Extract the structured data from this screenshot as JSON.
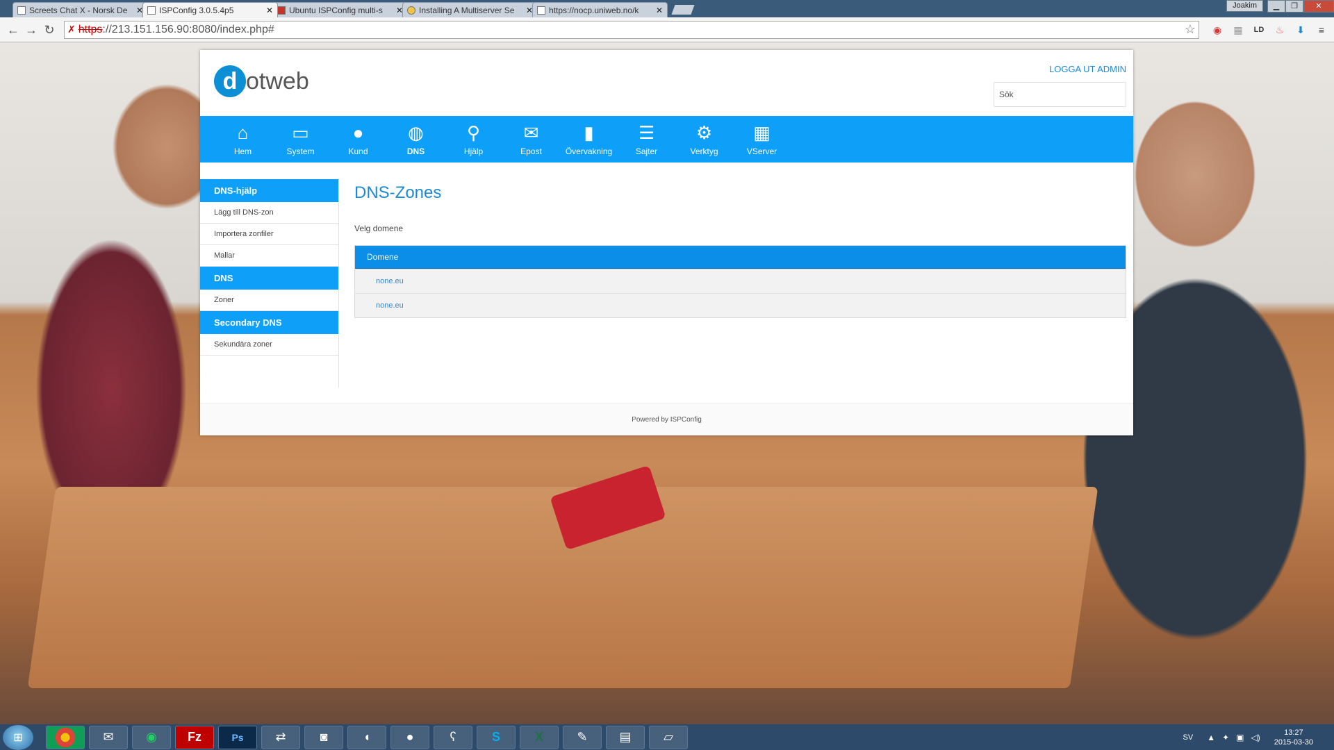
{
  "browser": {
    "tabs": [
      {
        "label": "Screets Chat X - Norsk De",
        "icon": "page-icon"
      },
      {
        "label": "ISPConfig 3.0.5.4p5",
        "icon": "page-icon",
        "active": true
      },
      {
        "label": "Ubuntu ISPConfig multi-s",
        "icon": "ispconfig-icon"
      },
      {
        "label": "Installing A Multiserver Se",
        "icon": "bulb-icon"
      },
      {
        "label": "https://nocp.uniweb.no/k",
        "icon": "page-icon"
      }
    ],
    "user_badge": "Joakim",
    "url_scheme": "https",
    "url_rest": "://213.151.156.90:8080/index.php#"
  },
  "header": {
    "logo_letter": "d",
    "logo_text": "otweb",
    "logout": "LOGGA UT ADMIN",
    "search_placeholder": "Sök"
  },
  "nav": [
    {
      "label": "Hem",
      "icon": "home-icon",
      "glyph": "⌂"
    },
    {
      "label": "System",
      "icon": "monitor-icon",
      "glyph": "▭"
    },
    {
      "label": "Kund",
      "icon": "user-icon",
      "glyph": "●"
    },
    {
      "label": "DNS",
      "icon": "globe-icon",
      "glyph": "◍",
      "active": true
    },
    {
      "label": "Hjälp",
      "icon": "search-icon",
      "glyph": "⚲"
    },
    {
      "label": "Epost",
      "icon": "envelope-icon",
      "glyph": "✉"
    },
    {
      "label": "Övervakning",
      "icon": "bar-chart-icon",
      "glyph": "▮"
    },
    {
      "label": "Sajter",
      "icon": "list-icon",
      "glyph": "☰"
    },
    {
      "label": "Verktyg",
      "icon": "gear-icon",
      "glyph": "⚙"
    },
    {
      "label": "VServer",
      "icon": "grid-icon",
      "glyph": "▦"
    }
  ],
  "sidebar": {
    "groups": [
      {
        "title": "DNS-hjälp",
        "items": [
          "Lägg till DNS-zon",
          "Importera zonfiler",
          "Mallar"
        ]
      },
      {
        "title": "DNS",
        "items": [
          "Zoner"
        ]
      },
      {
        "title": "Secondary DNS",
        "items": [
          "Sekundära zoner"
        ]
      }
    ]
  },
  "main": {
    "title": "DNS-Zones",
    "subtitle": "Velg domene",
    "table": {
      "header": "Domene",
      "rows": [
        "none.eu",
        "none.eu"
      ]
    }
  },
  "footer": {
    "text": "Powered by ISPConfig"
  },
  "taskbar": {
    "apps": [
      "chrome",
      "thunderbird",
      "spotify",
      "filezilla",
      "photoshop",
      "network",
      "media",
      "speaker",
      "obs",
      "bear",
      "skype",
      "excel",
      "notepad",
      "explorer",
      "files"
    ],
    "language": "SV",
    "time": "13:27",
    "date": "2015-03-30"
  },
  "colors": {
    "accent": "#0ea0f8",
    "link": "#1a8ad4"
  }
}
